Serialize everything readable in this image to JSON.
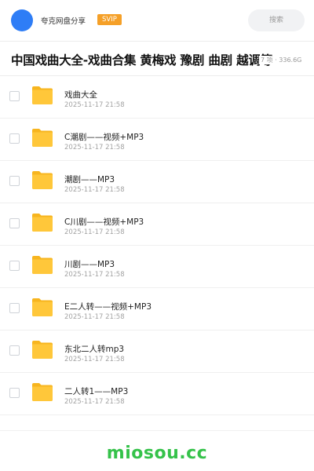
{
  "header": {
    "user_name": "夸克网盘分享",
    "badge": "SVIP",
    "search_placeholder": "搜索"
  },
  "share": {
    "title": "中国戏曲大全-戏曲合集 黄梅戏 豫剧 曲剧 越调等",
    "meta": "7 项 · 336.6G"
  },
  "colors": {
    "avatar": "#2e7df6",
    "badge": "#f5a028",
    "folder": "#ffc73a",
    "brand": "#35c24a"
  },
  "items": [
    {
      "name": "戏曲大全",
      "date": "2025-11-17 21:58",
      "icon": "folder-icon"
    },
    {
      "name": "C潮剧——视频+MP3",
      "date": "2025-11-17 21:58",
      "icon": "folder-icon"
    },
    {
      "name": "潮剧——MP3",
      "date": "2025-11-17 21:58",
      "icon": "folder-icon"
    },
    {
      "name": "C川剧——视频+MP3",
      "date": "2025-11-17 21:58",
      "icon": "folder-icon"
    },
    {
      "name": "川剧——MP3",
      "date": "2025-11-17 21:58",
      "icon": "folder-icon"
    },
    {
      "name": "E二人转——视频+MP3",
      "date": "2025-11-17 21:58",
      "icon": "folder-icon"
    },
    {
      "name": "东北二人转mp3",
      "date": "2025-11-17 21:58",
      "icon": "folder-icon"
    },
    {
      "name": "二人转1——MP3",
      "date": "2025-11-17 21:58",
      "icon": "folder-icon"
    }
  ],
  "footer": {
    "brand": "miosou.cc"
  }
}
